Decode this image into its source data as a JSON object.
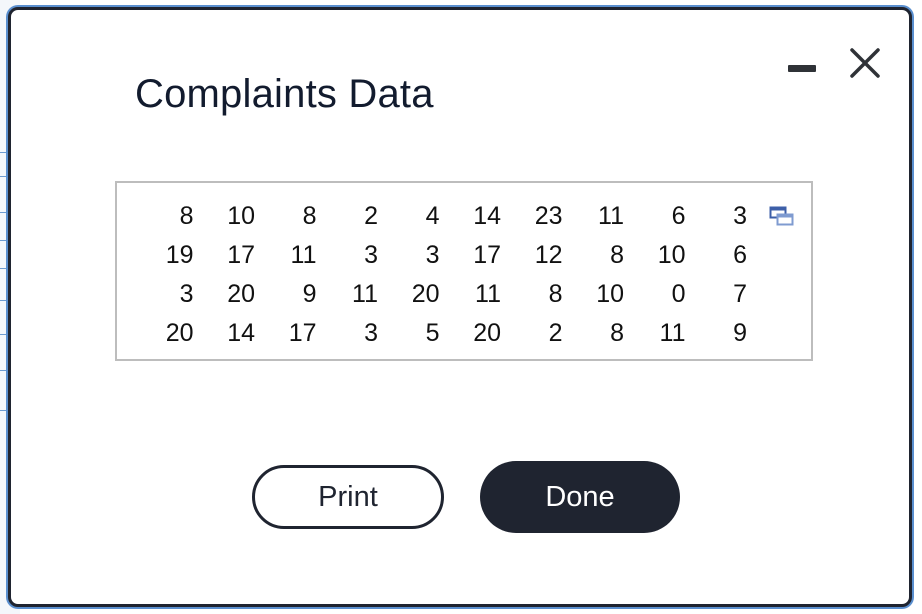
{
  "dialog": {
    "title": "Complaints Data",
    "minimize_icon": "minimize-icon",
    "close_icon": "close-icon"
  },
  "table": {
    "copy_icon": "copy-to-spreadsheet-icon",
    "rows": [
      [
        "8",
        "10",
        "8",
        "2",
        "4",
        "14",
        "23",
        "11",
        "6",
        "3"
      ],
      [
        "19",
        "17",
        "11",
        "3",
        "3",
        "17",
        "12",
        "8",
        "10",
        "6"
      ],
      [
        "3",
        "20",
        "9",
        "11",
        "20",
        "11",
        "8",
        "10",
        "0",
        "7"
      ],
      [
        "20",
        "14",
        "17",
        "3",
        "5",
        "20",
        "2",
        "8",
        "11",
        "9"
      ]
    ]
  },
  "buttons": {
    "print_label": "Print",
    "done_label": "Done"
  },
  "colors": {
    "dark": "#1f2430",
    "accent": "#5a8fcf",
    "border": "#bdbdbd"
  }
}
